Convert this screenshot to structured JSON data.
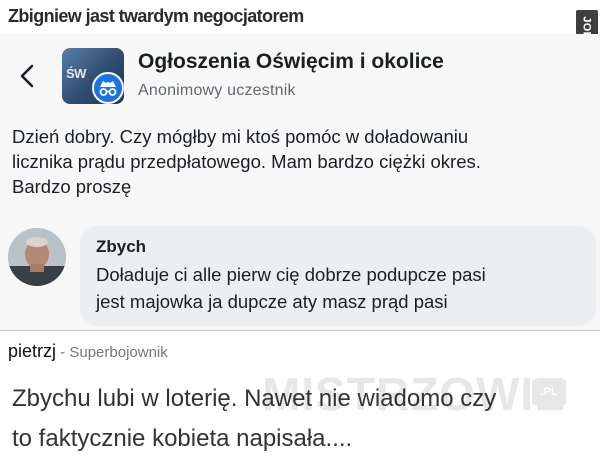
{
  "meme": {
    "title": "Zbigniew jast twardym negocjatorem",
    "watermark_side": "JOE MONSTER",
    "watermark_overlay": "MISTRZOWIE",
    "watermark_overlay_suffix": ".PL"
  },
  "post_header": {
    "group_name": "Ogłoszenia Oświęcim i okolice",
    "author": "Anonimowy uczestnik",
    "thumb_text": "ŚW",
    "icons": {
      "back": "chevron-left-icon",
      "anonymous": "incognito-icon"
    }
  },
  "post": {
    "lines": [
      "Dzień dobry.  Czy mógłby mi ktoś pomóc w doładowaniu",
      "licznika prądu przedpłatowego. Mam bardzo ciężki okres.",
      "Bardzo proszę"
    ]
  },
  "comment": {
    "author": "Zbych",
    "lines": [
      "Doładuje ci alle pierw cię dobrze podupcze pasi",
      "jest majowka ja dupcze aty masz prąd pasi"
    ]
  },
  "site_comment": {
    "user": "pietrzj",
    "separator": " - ",
    "rank": "Superbojownik",
    "lines": [
      "Zbychu lubi w loterię. Nawet nie wiadomo czy",
      "to faktycznie kobieta napisała...."
    ]
  },
  "colors": {
    "facebook_blue": "#1b74e4",
    "post_background": "#f7f7f7",
    "bubble_background": "#eceef1",
    "secondary_text": "#65676b"
  }
}
